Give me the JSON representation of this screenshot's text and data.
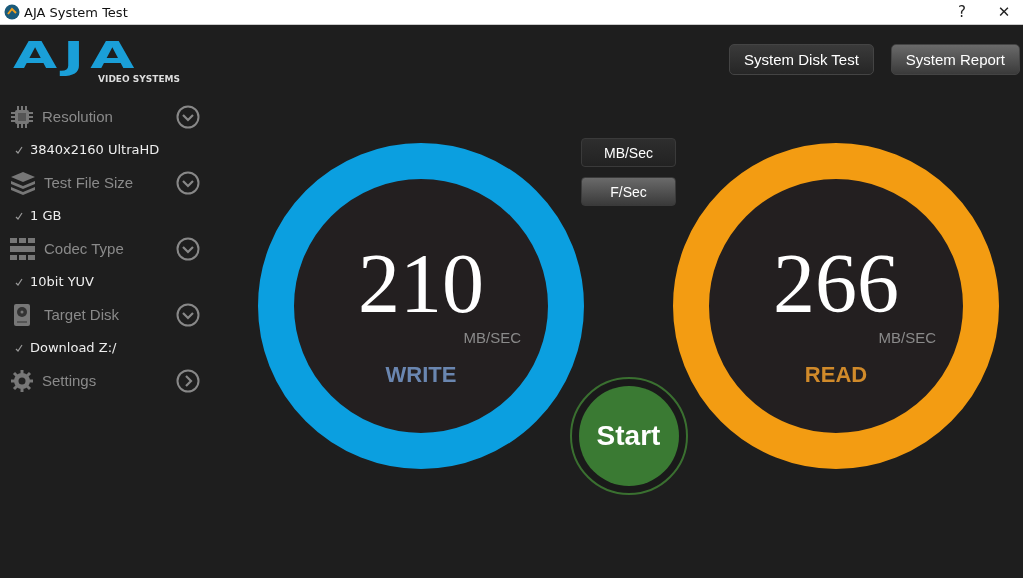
{
  "window": {
    "title": "AJA System Test",
    "controls": [
      "?",
      "✕"
    ]
  },
  "logo": {
    "mark": "AJA",
    "tagline": "VIDEO SYSTEMS"
  },
  "sidebar": {
    "items": [
      {
        "label": "Resolution",
        "kind": "dropdown",
        "value": "3840x2160 UltraHD"
      },
      {
        "label": "Test File Size",
        "kind": "dropdown",
        "value": "1 GB"
      },
      {
        "label": "Codec Type",
        "kind": "dropdown",
        "value": "10bit YUV"
      },
      {
        "label": "Target Disk",
        "kind": "dropdown",
        "value": "Download Z:/"
      },
      {
        "label": "Settings",
        "kind": "link"
      }
    ]
  },
  "toolbar": {
    "buttons": [
      {
        "label": "System Disk Test",
        "selected": true
      },
      {
        "label": "System Report",
        "selected": false
      }
    ]
  },
  "units": [
    {
      "label": "MB/Sec",
      "selected": true
    },
    {
      "label": "F/Sec",
      "selected": false
    }
  ],
  "gauges": [
    {
      "value": "210",
      "unit": "MB/SEC",
      "label": "WRITE",
      "color": "#0b9fe0"
    },
    {
      "value": "266",
      "unit": "MB/SEC",
      "label": "READ",
      "color": "#f39c12"
    }
  ],
  "start_button": {
    "label": "Start"
  }
}
